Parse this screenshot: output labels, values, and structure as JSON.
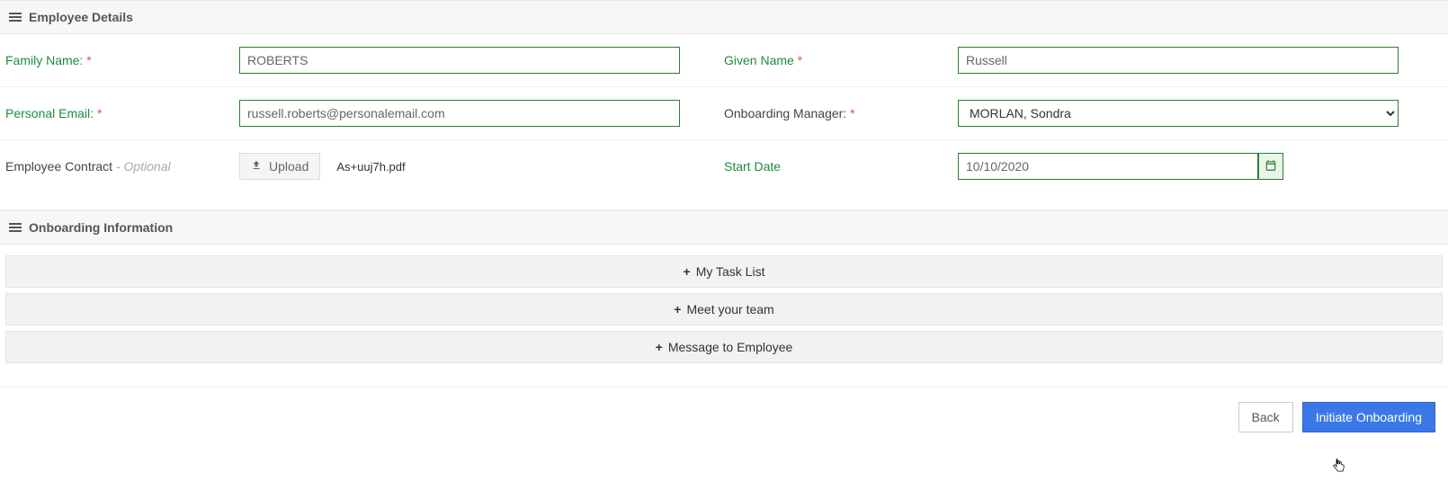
{
  "sections": {
    "employee_details": {
      "title": "Employee Details"
    },
    "onboarding_info": {
      "title": "Onboarding Information"
    }
  },
  "employee": {
    "family_name": {
      "label": "Family Name:",
      "value": "ROBERTS",
      "required": true
    },
    "given_name": {
      "label": "Given Name",
      "value": "Russell",
      "required": true
    },
    "personal_email": {
      "label": "Personal Email:",
      "value": "russell.roberts@personalemail.com",
      "required": true
    },
    "onboarding_manager": {
      "label": "Onboarding Manager:",
      "value": "MORLAN, Sondra",
      "required": true
    },
    "contract": {
      "label": "Employee Contract",
      "optional": "- Optional",
      "upload_label": "Upload",
      "file_name": "As+uuj7h.pdf"
    },
    "start_date": {
      "label": "Start Date",
      "value": "10/10/2020"
    }
  },
  "onboarding": {
    "items": [
      {
        "label": "My Task List"
      },
      {
        "label": "Meet your team"
      },
      {
        "label": "Message to Employee"
      }
    ]
  },
  "footer": {
    "back": "Back",
    "initiate": "Initiate Onboarding"
  }
}
